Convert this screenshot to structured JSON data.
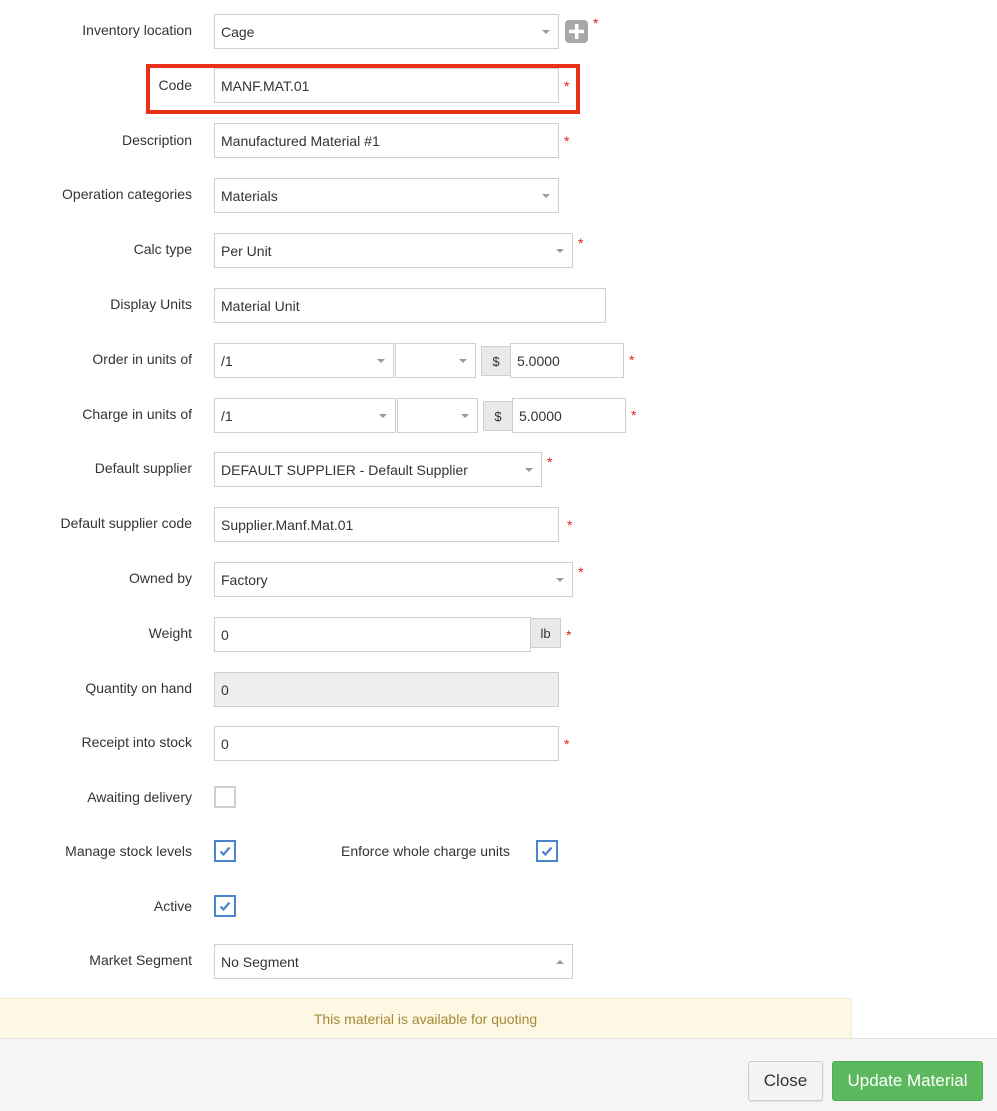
{
  "form": {
    "inventory_location": {
      "label": "Inventory location",
      "value": "Cage"
    },
    "code": {
      "label": "Code",
      "value": "MANF.MAT.01"
    },
    "description": {
      "label": "Description",
      "value": "Manufactured Material #1"
    },
    "operation_categories": {
      "label": "Operation categories",
      "value": "Materials"
    },
    "calc_type": {
      "label": "Calc type",
      "value": "Per Unit"
    },
    "display_units": {
      "label": "Display Units",
      "value": "Material Unit"
    },
    "order_in_units": {
      "label": "Order in units of",
      "unit": "/1",
      "sub": "",
      "currency": "$",
      "price": "5.0000"
    },
    "charge_in_units": {
      "label": "Charge in units of",
      "unit": "/1",
      "sub": "",
      "currency": "$",
      "price": "5.0000"
    },
    "default_supplier": {
      "label": "Default supplier",
      "value": "DEFAULT SUPPLIER - Default Supplier"
    },
    "default_supplier_code": {
      "label": "Default supplier code",
      "value": "Supplier.Manf.Mat.01"
    },
    "owned_by": {
      "label": "Owned by",
      "value": "Factory"
    },
    "weight": {
      "label": "Weight",
      "value": "0",
      "unit": "lb"
    },
    "quantity_on_hand": {
      "label": "Quantity on hand",
      "value": "0"
    },
    "receipt_into_stock": {
      "label": "Receipt into stock",
      "value": "0"
    },
    "awaiting_delivery": {
      "label": "Awaiting delivery",
      "checked": false
    },
    "manage_stock_levels": {
      "label": "Manage stock levels",
      "checked": true
    },
    "enforce_whole_charge_units": {
      "label": "Enforce whole charge units",
      "checked": true
    },
    "active": {
      "label": "Active",
      "checked": true
    },
    "market_segment": {
      "label": "Market Segment",
      "value": "No Segment"
    },
    "required_mark": "*"
  },
  "notice": {
    "text": "This material is available for quoting"
  },
  "footer": {
    "close_label": "Close",
    "update_label": "Update Material"
  },
  "colors": {
    "highlight": "#e8301a",
    "required": "#dd2222",
    "primary_button": "#5cb85c",
    "checkbox_checked": "#4a84d1",
    "notice_bg": "#fcf8e3",
    "notice_text": "#a8893a"
  }
}
